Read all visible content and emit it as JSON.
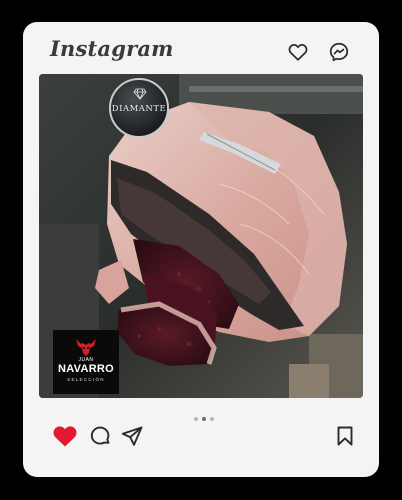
{
  "app": {
    "brand": "Instagram"
  },
  "header_icons": [
    "heart-outline-icon",
    "messenger-icon"
  ],
  "post": {
    "image_alt_subject": "dry-aged beef rib",
    "tag_label": "DIAMANTE",
    "logo": {
      "first_name": "JUAN",
      "last_name": "NAVARRO",
      "subtitle": "SELECCIÓN"
    },
    "carousel": {
      "count": 3,
      "active_index": 1
    }
  },
  "actions": {
    "like": {
      "icon": "heart-filled-icon",
      "liked": true,
      "color": "#e3192f"
    },
    "comment": {
      "icon": "comment-icon"
    },
    "share": {
      "icon": "send-icon"
    },
    "save": {
      "icon": "bookmark-icon"
    }
  },
  "colors": {
    "background": "#000000",
    "card": "#f4f4f5",
    "icon": "#2b2b2e",
    "logo_accent": "#d21f26"
  }
}
